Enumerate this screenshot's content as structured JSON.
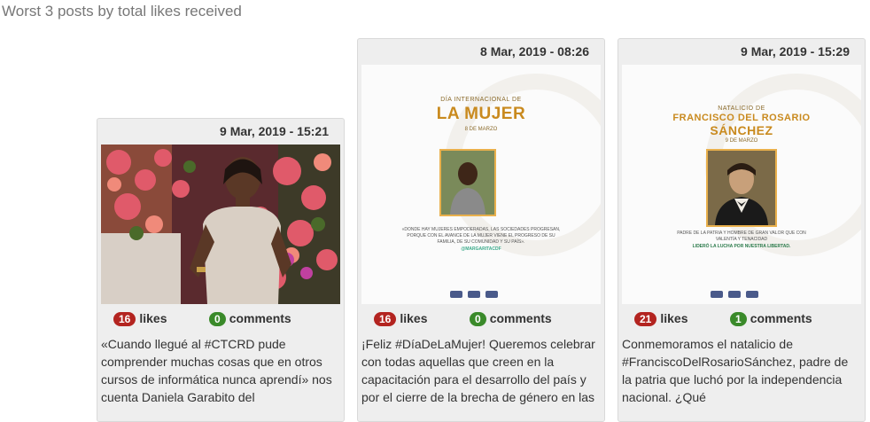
{
  "heading": "Worst 3 posts by total likes received",
  "likes_label": "likes",
  "comments_label": "comments",
  "colors": {
    "likes_badge": "#b32420",
    "comments_badge": "#3a8a2a",
    "poster_gold": "#c98a1e"
  },
  "posts": [
    {
      "date": "9 Mar, 2019 - 15:21",
      "likes": "16",
      "comments": "0",
      "caption": "«Cuando llegué al #CTCRD pude comprender muchas cosas que en otros cursos de informática nunca aprendí» nos cuenta Daniela Garabito del"
    },
    {
      "date": "8 Mar, 2019 - 08:26",
      "likes": "16",
      "comments": "0",
      "caption": "¡Feliz #DíaDeLaMujer! Queremos celebrar con todas aquellas que creen en la capacitación para el desarrollo del país y por el cierre de la brecha de género en las",
      "poster": {
        "pre": "DÍA INTERNACIONAL DE",
        "title": "LA MUJER",
        "sub": "8 DE MARZO",
        "quote": "«DONDE HAY MUJERES EMPODERADAS, LAS SOCIEDADES PROGRESAN, PORQUE CON EL AVANCE DE LA MUJER VIENE EL PROGRESO DE SU FAMILIA, DE SU COMUNIDAD Y SU PAÍS».",
        "tag": "@MARGARITACDF"
      }
    },
    {
      "date": "9 Mar, 2019 - 15:29",
      "likes": "21",
      "comments": "1",
      "caption": "Conmemoramos el natalicio de #FranciscoDelRosarioSánchez, padre de la patria que luchó por la independencia nacional. ¿Qué",
      "poster": {
        "pre": "NATALICIO DE",
        "title": "FRANCISCO DEL ROSARIO",
        "title2": "SÁNCHEZ",
        "sub": "9 DE MARZO",
        "quote": "PADRE DE LA PATRIA Y HOMBRE DE GRAN VALOR QUE CON VALENTÍA Y TENACIDAD",
        "tag": "LIDERÓ LA LUCHA POR NUESTRA LIBERTAD."
      }
    }
  ]
}
